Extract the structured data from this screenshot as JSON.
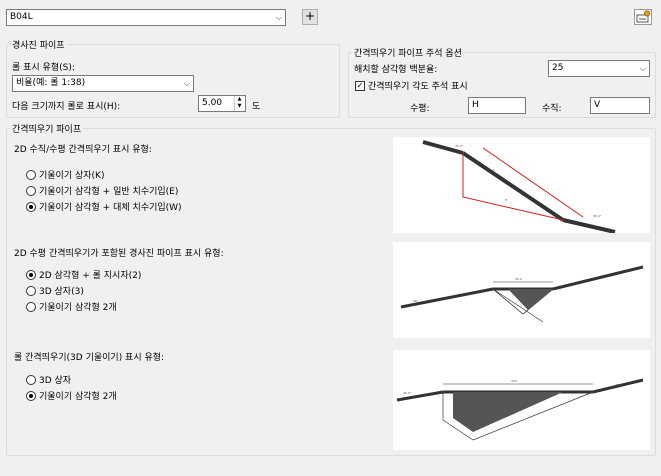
{
  "style_combo": {
    "value": "B04L"
  },
  "add_button": "+",
  "pipe_group": {
    "legend": "경사진 파이프",
    "display_type_label": "롤 표시 유형(S):",
    "display_type_value": "비율(예: 롤 1:38)",
    "threshold_label": "다음 크기까지 롤로 표시(H):",
    "threshold_value": "5.00",
    "threshold_unit": "도"
  },
  "note_group": {
    "legend": "간격띄우기 파이프 주석 옵션",
    "hatch_label": "해치할 삼각형 백분율:",
    "hatch_value": "25",
    "angle_note_label": "간격띄우기 각도 주석 표시",
    "horizontal_label": "수평:",
    "horizontal_value": "H",
    "vertical_label": "수직:",
    "vertical_value": "V"
  },
  "offset_group": {
    "legend": "간격띄우기 파이프",
    "section1": {
      "title": "2D 수직/수평 간격띄우기 표시 유형:",
      "options": [
        "기울이기 상자(K)",
        "기울이기 삼각형 + 일반 치수기입(E)",
        "기울이기 삼각형 + 대체 치수기입(W)"
      ],
      "selected": 2
    },
    "section2": {
      "title": "2D 수평 간격띄우기가 포함된 경사진 파이프 표시 유형:",
      "options": [
        "2D 삼각형 + 롤 지시자(2)",
        "3D 상자(3)",
        "기울이기 삼각형 2개"
      ],
      "selected": 0
    },
    "section3": {
      "title": "롤 간격띄우기(3D 기울이기) 표시 유형:",
      "options": [
        "3D 상자",
        "기울이기 삼각형 2개"
      ],
      "selected": 1
    }
  },
  "colors": {
    "accent_red": "#d02020",
    "pipe": "#333333"
  },
  "icons": {
    "settings": "edit-style-icon"
  }
}
